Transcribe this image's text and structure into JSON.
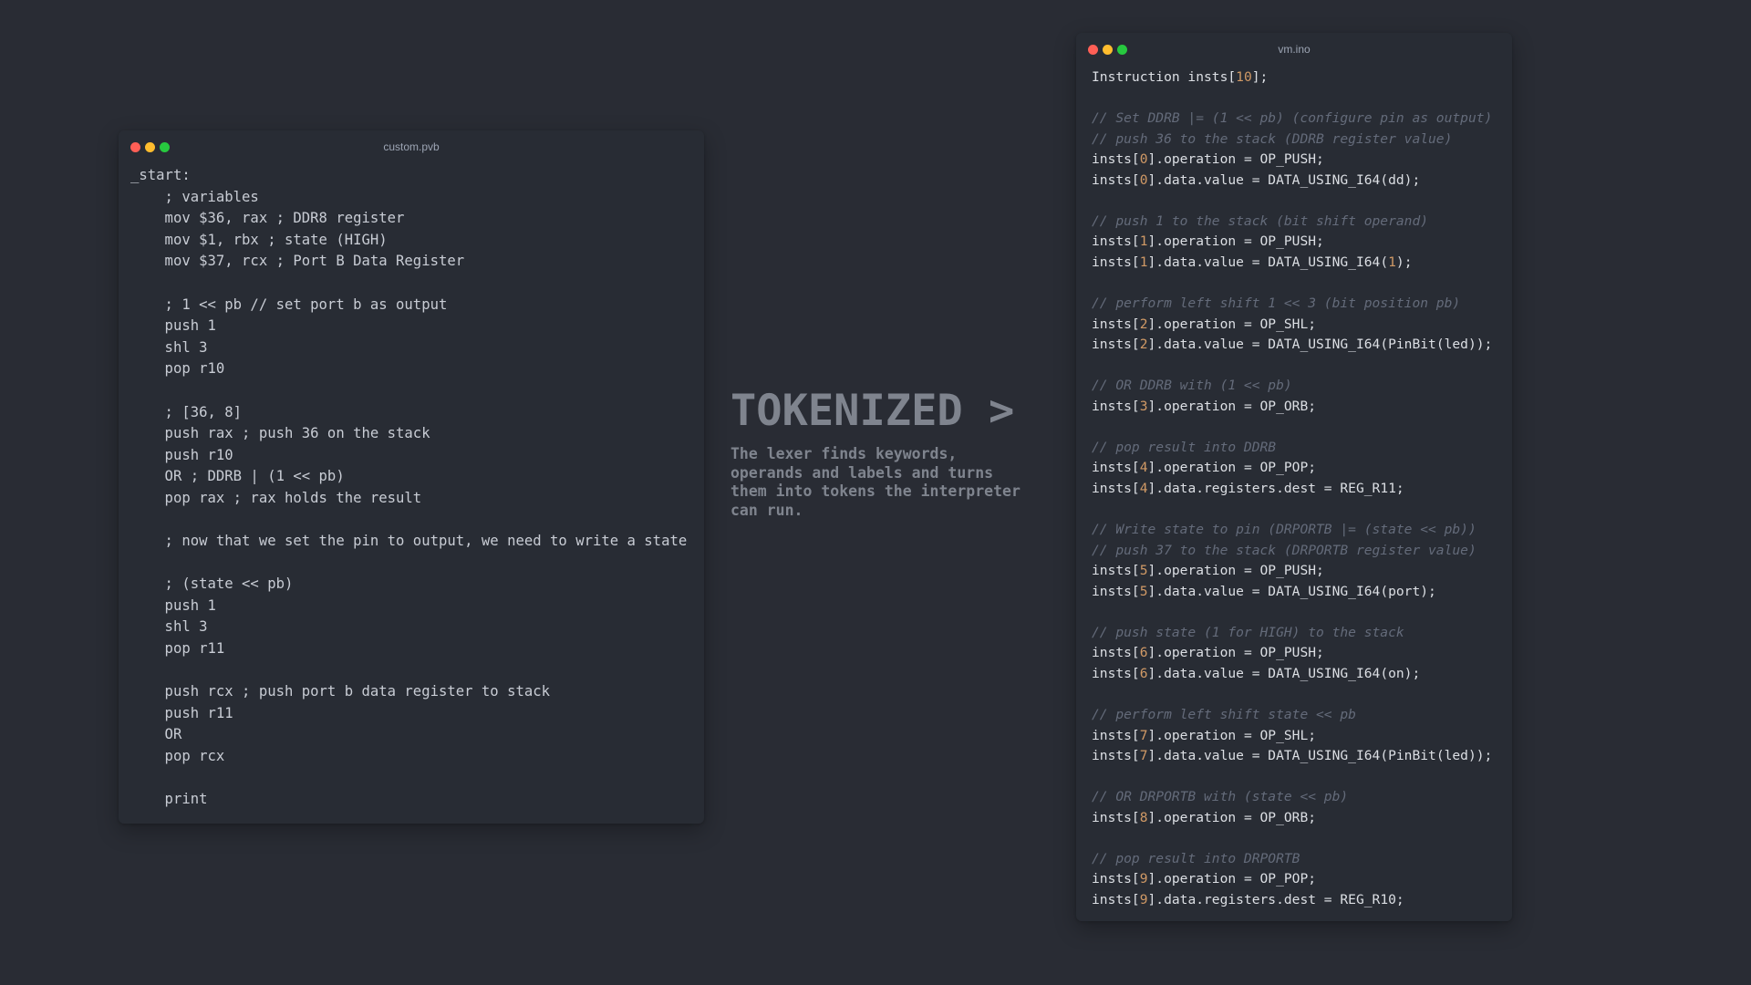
{
  "left_window": {
    "filename": "custom.pvb",
    "lines": [
      "_start:",
      "    ; variables",
      "    mov $36, rax ; DDR8 register",
      "    mov $1, rbx ; state (HIGH)",
      "    mov $37, rcx ; Port B Data Register",
      "",
      "    ; 1 << pb // set port b as output",
      "    push 1",
      "    shl 3",
      "    pop r10",
      "",
      "    ; [36, 8]",
      "    push rax ; push 36 on the stack",
      "    push r10",
      "    OR ; DDRB | (1 << pb)",
      "    pop rax ; rax holds the result",
      "",
      "    ; now that we set the pin to output, we need to write a state",
      "",
      "    ; (state << pb)",
      "    push 1",
      "    shl 3",
      "    pop r11",
      "",
      "    push rcx ; push port b data register to stack",
      "    push r11",
      "    OR",
      "    pop rcx",
      "",
      "    print"
    ]
  },
  "center": {
    "title": "TOKENIZED >",
    "description": "The lexer finds keywords, operands and labels and turns them into tokens the interpreter can run."
  },
  "right_window": {
    "filename": "vm.ino",
    "lines": [
      [
        {
          "t": "Instruction insts["
        },
        {
          "t": "10",
          "c": "num"
        },
        {
          "t": "];"
        }
      ],
      [],
      [
        {
          "t": "// Set DDRB |= (1 << pb) (configure pin as output)",
          "c": "cm"
        }
      ],
      [
        {
          "t": "// push 36 to the stack (DDRB register value)",
          "c": "cm"
        }
      ],
      [
        {
          "t": "insts["
        },
        {
          "t": "0",
          "c": "num"
        },
        {
          "t": "].operation = OP_PUSH;"
        }
      ],
      [
        {
          "t": "insts["
        },
        {
          "t": "0",
          "c": "num"
        },
        {
          "t": "].data.value = DATA_USING_I64(dd);"
        }
      ],
      [],
      [
        {
          "t": "// push 1 to the stack (bit shift operand)",
          "c": "cm"
        }
      ],
      [
        {
          "t": "insts["
        },
        {
          "t": "1",
          "c": "num"
        },
        {
          "t": "].operation = OP_PUSH;"
        }
      ],
      [
        {
          "t": "insts["
        },
        {
          "t": "1",
          "c": "num"
        },
        {
          "t": "].data.value = DATA_USING_I64("
        },
        {
          "t": "1",
          "c": "num"
        },
        {
          "t": ");"
        }
      ],
      [],
      [
        {
          "t": "// perform left shift 1 << 3 (bit position pb)",
          "c": "cm"
        }
      ],
      [
        {
          "t": "insts["
        },
        {
          "t": "2",
          "c": "num"
        },
        {
          "t": "].operation = OP_SHL;"
        }
      ],
      [
        {
          "t": "insts["
        },
        {
          "t": "2",
          "c": "num"
        },
        {
          "t": "].data.value = DATA_USING_I64(PinBit(led));"
        }
      ],
      [],
      [
        {
          "t": "// OR DDRB with (1 << pb)",
          "c": "cm"
        }
      ],
      [
        {
          "t": "insts["
        },
        {
          "t": "3",
          "c": "num"
        },
        {
          "t": "].operation = OP_ORB;"
        }
      ],
      [],
      [
        {
          "t": "// pop result into DDRB",
          "c": "cm"
        }
      ],
      [
        {
          "t": "insts["
        },
        {
          "t": "4",
          "c": "num"
        },
        {
          "t": "].operation = OP_POP;"
        }
      ],
      [
        {
          "t": "insts["
        },
        {
          "t": "4",
          "c": "num"
        },
        {
          "t": "].data.registers.dest = REG_R11;"
        }
      ],
      [],
      [
        {
          "t": "// Write state to pin (DRPORTB |= (state << pb))",
          "c": "cm"
        }
      ],
      [
        {
          "t": "// push 37 to the stack (DRPORTB register value)",
          "c": "cm"
        }
      ],
      [
        {
          "t": "insts["
        },
        {
          "t": "5",
          "c": "num"
        },
        {
          "t": "].operation = OP_PUSH;"
        }
      ],
      [
        {
          "t": "insts["
        },
        {
          "t": "5",
          "c": "num"
        },
        {
          "t": "].data.value = DATA_USING_I64(port);"
        }
      ],
      [],
      [
        {
          "t": "// push state (1 for HIGH) to the stack",
          "c": "cm"
        }
      ],
      [
        {
          "t": "insts["
        },
        {
          "t": "6",
          "c": "num"
        },
        {
          "t": "].operation = OP_PUSH;"
        }
      ],
      [
        {
          "t": "insts["
        },
        {
          "t": "6",
          "c": "num"
        },
        {
          "t": "].data.value = DATA_USING_I64(on);"
        }
      ],
      [],
      [
        {
          "t": "// perform left shift state << pb",
          "c": "cm"
        }
      ],
      [
        {
          "t": "insts["
        },
        {
          "t": "7",
          "c": "num"
        },
        {
          "t": "].operation = OP_SHL;"
        }
      ],
      [
        {
          "t": "insts["
        },
        {
          "t": "7",
          "c": "num"
        },
        {
          "t": "].data.value = DATA_USING_I64(PinBit(led));"
        }
      ],
      [],
      [
        {
          "t": "// OR DRPORTB with (state << pb)",
          "c": "cm"
        }
      ],
      [
        {
          "t": "insts["
        },
        {
          "t": "8",
          "c": "num"
        },
        {
          "t": "].operation = OP_ORB;"
        }
      ],
      [],
      [
        {
          "t": "// pop result into DRPORTB",
          "c": "cm"
        }
      ],
      [
        {
          "t": "insts["
        },
        {
          "t": "9",
          "c": "num"
        },
        {
          "t": "].operation = OP_POP;"
        }
      ],
      [
        {
          "t": "insts["
        },
        {
          "t": "9",
          "c": "num"
        },
        {
          "t": "].data.registers.dest = REG_R10;"
        }
      ]
    ]
  },
  "colors": {
    "background": "#292c34",
    "window": "#282c34",
    "code_text": "#dcdfe4",
    "comment": "#646b7a",
    "number": "#d19a66",
    "heading": "#7f848e",
    "dot_close": "#ff5f56",
    "dot_minimize": "#ffbd2e",
    "dot_maximize": "#27c93f"
  }
}
